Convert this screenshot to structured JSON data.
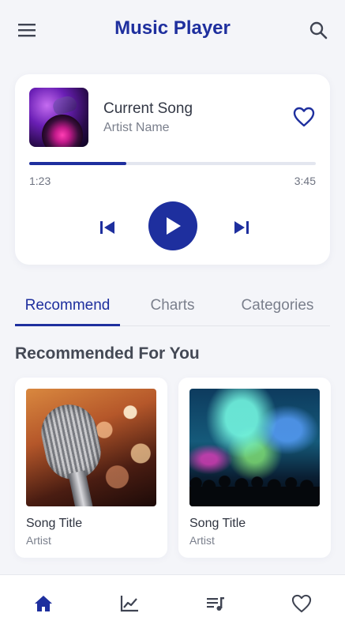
{
  "header": {
    "title": "Music Player",
    "menu_icon": "menu-icon",
    "search_icon": "search-icon"
  },
  "now_playing": {
    "title": "Current Song",
    "artist": "Artist Name",
    "current_time": "1:23",
    "total_time": "3:45",
    "progress_fraction": 0.34,
    "favorite_icon": "heart-outline-icon",
    "controls": [
      "skip-previous-icon",
      "play-icon",
      "skip-next-icon"
    ]
  },
  "tabs": [
    {
      "label": "Recommend",
      "active": true
    },
    {
      "label": "Charts",
      "active": false
    },
    {
      "label": "Categories",
      "active": false
    }
  ],
  "recommended": {
    "section_title": "Recommended For You",
    "items": [
      {
        "title": "Song Title",
        "artist": "Artist"
      },
      {
        "title": "Song Title",
        "artist": "Artist"
      }
    ]
  },
  "bottom_nav": [
    {
      "icon": "home-icon",
      "active": true
    },
    {
      "icon": "chart-icon",
      "active": false
    },
    {
      "icon": "playlist-icon",
      "active": false
    },
    {
      "icon": "heart-icon",
      "active": false
    }
  ],
  "colors": {
    "accent": "#1e2f9e",
    "background": "#f4f5f9",
    "card": "#ffffff",
    "muted_text": "#7a7f8c"
  }
}
